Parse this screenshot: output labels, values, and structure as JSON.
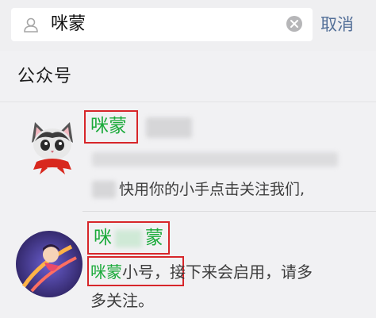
{
  "search": {
    "query": "咪蒙",
    "cancel_label": "取消"
  },
  "section": {
    "title": "公众号"
  },
  "results": [
    {
      "name": "咪蒙",
      "description_visible": "快用你的小手点击关注我们,"
    },
    {
      "name_part1": "咪",
      "name_part2": "蒙",
      "desc_highlight": "咪蒙",
      "desc_after_highlight": "小号",
      "desc_rest_line1": "，接下来会启用，请多",
      "desc_line2": "多关注。"
    }
  ],
  "colors": {
    "match_green": "#1aaa3a",
    "cancel_blue": "#536f98",
    "highlight_box_red": "#d7262a"
  }
}
